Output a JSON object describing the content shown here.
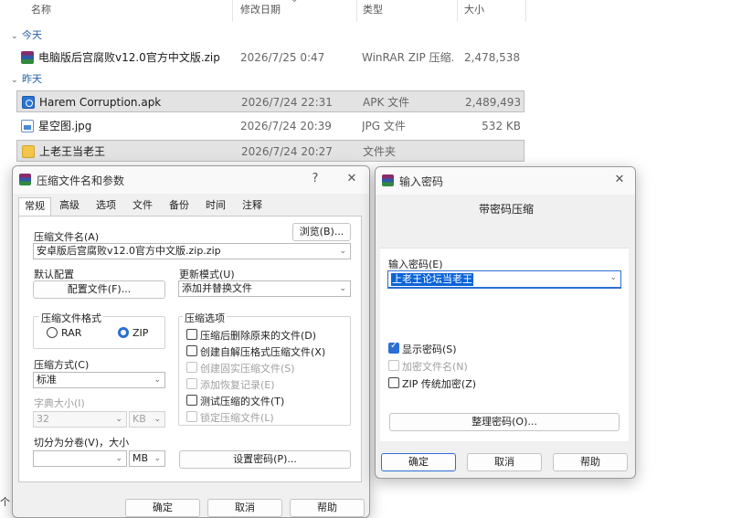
{
  "explorer": {
    "columns": {
      "name": "名称",
      "date": "修改日期",
      "type": "类型",
      "size": "大小"
    },
    "groups": {
      "today": "今天",
      "yesterday": "昨天"
    },
    "files": [
      {
        "name": "电脑版后宫腐败v12.0官方中文版.zip",
        "date": "2026/7/25 0:47",
        "type": "WinRAR ZIP 压缩...",
        "size": "2,478,538..."
      },
      {
        "name": "Harem Corruption.apk",
        "date": "2026/7/24 22:31",
        "type": "APK 文件",
        "size": "2,489,493..."
      },
      {
        "name": "星空图.jpg",
        "date": "2026/7/24 20:39",
        "type": "JPG 文件",
        "size": "532 KB"
      },
      {
        "name": "上老王当老王",
        "date": "2026/7/24 20:27",
        "type": "文件夹",
        "size": ""
      }
    ],
    "cut_text": "个"
  },
  "archive_dialog": {
    "title": "压缩文件名和参数",
    "help_btn": "?",
    "close_btn": "✕",
    "tabs": [
      "常规",
      "高级",
      "选项",
      "文件",
      "备份",
      "时间",
      "注释"
    ],
    "archive_name_label": "压缩文件名(A)",
    "browse_button": "浏览(B)...",
    "archive_name_value": "安卓版后宫腐败v12.0官方中文版.zip.zip",
    "default_profile_label": "默认配置",
    "profile_button": "配置文件(F)...",
    "update_mode_label": "更新模式(U)",
    "update_mode_value": "添加并替换文件",
    "format_group_label": "压缩文件格式",
    "format_rar": "RAR",
    "format_zip": "ZIP",
    "options_group_label": "压缩选项",
    "options": [
      "压缩后删除原来的文件(D)",
      "创建自解压格式压缩文件(X)",
      "创建固实压缩文件(S)",
      "添加恢复记录(E)",
      "测试压缩的文件(T)",
      "锁定压缩文件(L)"
    ],
    "method_label": "压缩方式(C)",
    "method_value": "标准",
    "dict_label": "字典大小(I)",
    "dict_value": "32",
    "dict_unit": "KB",
    "split_label": "切分为分卷(V)，大小",
    "split_unit": "MB",
    "set_password_button": "设置密码(P)...",
    "ok_button": "确定",
    "cancel_button": "取消",
    "help_button": "帮助"
  },
  "password_dialog": {
    "title": "输入密码",
    "close_btn": "✕",
    "heading": "带密码压缩",
    "enter_password_label": "输入密码(E)",
    "password_value": "上老王论坛当老王",
    "show_password": "显示密码(S)",
    "encrypt_names": "加密文件名(N)",
    "zip_legacy": "ZIP 传统加密(Z)",
    "organize_button": "整理密码(O)...",
    "ok_button": "确定",
    "cancel_button": "取消",
    "help_button": "帮助"
  },
  "colors": {
    "accent": "#2a6fd4",
    "selection": "#0a64d8",
    "group_header": "#1f5fa8"
  },
  "icons": [
    "winrar-icon",
    "apk-icon",
    "image-icon",
    "folder-icon",
    "chevron-down-icon",
    "close-icon",
    "help-icon"
  ]
}
